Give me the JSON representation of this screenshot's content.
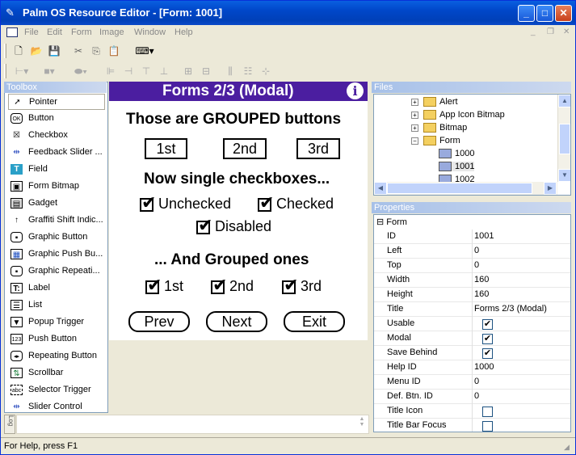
{
  "window": {
    "title": "Palm OS Resource Editor - [Form: 1001]"
  },
  "menu": {
    "items": [
      "File",
      "Edit",
      "Form",
      "Image",
      "Window",
      "Help"
    ]
  },
  "toolbox": {
    "header": "Toolbox",
    "items": [
      {
        "label": "Pointer",
        "icon": "pointer-icon"
      },
      {
        "label": "Button",
        "icon": "button-icon"
      },
      {
        "label": "Checkbox",
        "icon": "checkbox-icon"
      },
      {
        "label": "Feedback Slider ...",
        "icon": "feedback-slider-icon"
      },
      {
        "label": "Field",
        "icon": "field-icon"
      },
      {
        "label": "Form Bitmap",
        "icon": "form-bitmap-icon"
      },
      {
        "label": "Gadget",
        "icon": "gadget-icon"
      },
      {
        "label": "Graffiti Shift Indic...",
        "icon": "graffiti-shift-icon"
      },
      {
        "label": "Graphic Button",
        "icon": "graphic-button-icon"
      },
      {
        "label": "Graphic Push Bu...",
        "icon": "graphic-push-button-icon"
      },
      {
        "label": "Graphic Repeati...",
        "icon": "graphic-repeating-icon"
      },
      {
        "label": "Label",
        "icon": "label-icon"
      },
      {
        "label": "List",
        "icon": "list-icon"
      },
      {
        "label": "Popup Trigger",
        "icon": "popup-trigger-icon"
      },
      {
        "label": "Push Button",
        "icon": "push-button-icon"
      },
      {
        "label": "Repeating Button",
        "icon": "repeating-button-icon"
      },
      {
        "label": "Scrollbar",
        "icon": "scrollbar-icon"
      },
      {
        "label": "Selector Trigger",
        "icon": "selector-trigger-icon"
      },
      {
        "label": "Slider Control",
        "icon": "slider-control-icon"
      }
    ]
  },
  "form": {
    "title": "Forms 2/3 (Modal)",
    "info_glyph": "i",
    "heading1": "Those are GROUPED buttons",
    "grouped_buttons": [
      "1st",
      "2nd",
      "3rd"
    ],
    "heading2": "Now single checkboxes...",
    "checkboxes": [
      "Unchecked",
      "Checked",
      "Disabled"
    ],
    "heading3": "... And Grouped ones",
    "grouped_checks": [
      "1st",
      "2nd",
      "3rd"
    ],
    "nav_buttons": [
      "Prev",
      "Next",
      "Exit"
    ]
  },
  "files": {
    "header": "Files",
    "tree": [
      "Alert",
      "App Icon Bitmap",
      "Bitmap",
      "Form",
      "1000",
      "1001",
      "1002"
    ]
  },
  "properties": {
    "header": "Properties",
    "group": "Form",
    "rows": [
      {
        "key": "ID",
        "value": "1001"
      },
      {
        "key": "Left",
        "value": "0"
      },
      {
        "key": "Top",
        "value": "0"
      },
      {
        "key": "Width",
        "value": "160"
      },
      {
        "key": "Height",
        "value": "160"
      },
      {
        "key": "Title",
        "value": "Forms 2/3 (Modal)"
      },
      {
        "key": "Usable",
        "value": "",
        "checked": true
      },
      {
        "key": "Modal",
        "value": "",
        "checked": true
      },
      {
        "key": "Save Behind",
        "value": "",
        "checked": true
      },
      {
        "key": "Help ID",
        "value": "1000"
      },
      {
        "key": "Menu ID",
        "value": "0"
      },
      {
        "key": "Def. Btn. ID",
        "value": "0"
      },
      {
        "key": "Title Icon",
        "value": "",
        "checked": false
      },
      {
        "key": "Title Bar Focus",
        "value": "",
        "checked": false
      }
    ]
  },
  "log_tab": "Log",
  "status": {
    "text": "For Help, press F1"
  }
}
